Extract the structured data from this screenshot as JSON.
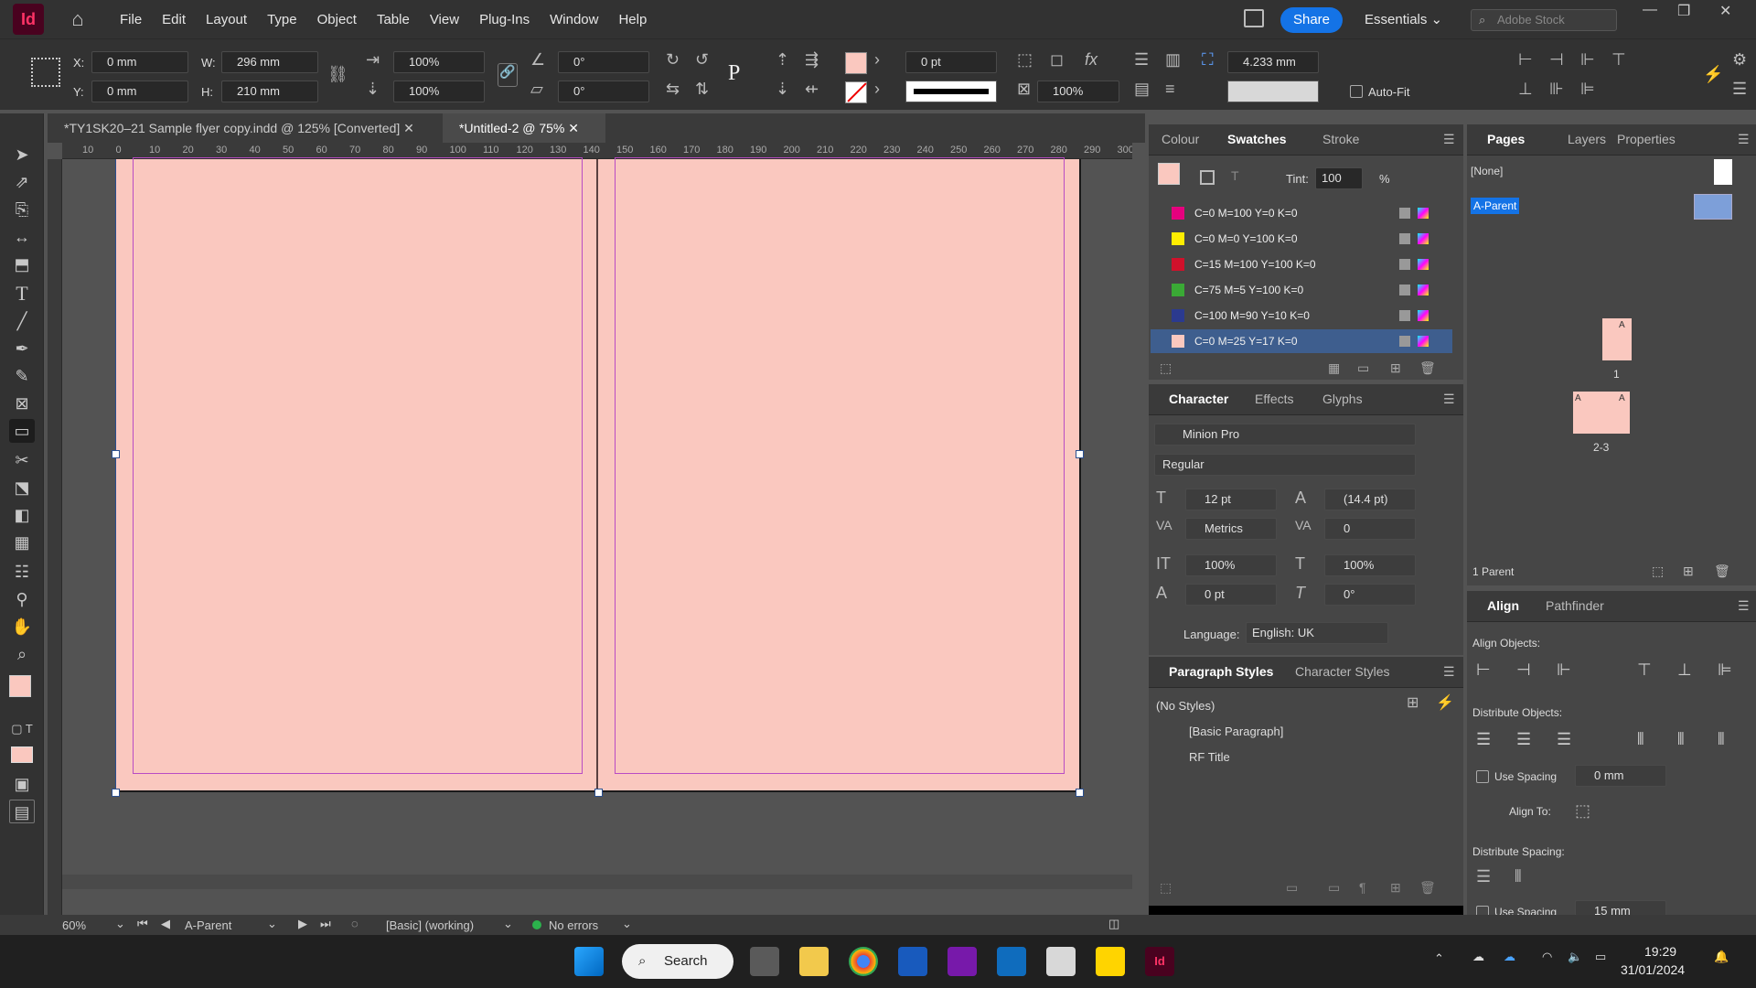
{
  "app": {
    "logo": "Id"
  },
  "menu": [
    "File",
    "Edit",
    "Layout",
    "Type",
    "Object",
    "Table",
    "View",
    "Plug-Ins",
    "Window",
    "Help"
  ],
  "share_label": "Share",
  "workspace": "Essentials",
  "stock_placeholder": "Adobe Stock",
  "control": {
    "x_label": "X:",
    "x": "0 mm",
    "y_label": "Y:",
    "y": "0 mm",
    "w_label": "W:",
    "w": "296 mm",
    "h_label": "H:",
    "h": "210 mm",
    "scale_x": "100%",
    "scale_y": "100%",
    "rotate": "0°",
    "shear": "0°",
    "stroke_weight": "0 pt",
    "opacity": "100%",
    "gutter": "4.233 mm",
    "autofit": "Auto-Fit"
  },
  "tabs": [
    {
      "label": "*TY1SK20–21 Sample flyer copy.indd @ 125% [Converted]"
    },
    {
      "label": "*Untitled-2 @ 75%"
    }
  ],
  "ruler_marks": [
    "10",
    "0",
    "10",
    "20",
    "30",
    "40",
    "50",
    "60",
    "70",
    "80",
    "90",
    "100",
    "110",
    "120",
    "130",
    "140",
    "150",
    "160",
    "170",
    "180",
    "190",
    "200",
    "210",
    "220",
    "230",
    "240",
    "250",
    "260",
    "270",
    "280",
    "290",
    "300"
  ],
  "swatches_panel": {
    "tabs": [
      "Colour",
      "Swatches",
      "Stroke"
    ],
    "tint_label": "Tint:",
    "tint": "100",
    "tint_unit": "%",
    "items": [
      {
        "name": "C=0 M=100 Y=0 K=0",
        "color": "#e6007e"
      },
      {
        "name": "C=0 M=0 Y=100 K=0",
        "color": "#ffed00"
      },
      {
        "name": "C=15 M=100 Y=100 K=0",
        "color": "#d0112b"
      },
      {
        "name": "C=75 M=5 Y=100 K=0",
        "color": "#3aa935"
      },
      {
        "name": "C=100 M=90 Y=10 K=0",
        "color": "#2b3a8f"
      },
      {
        "name": "C=0 M=25 Y=17 K=0",
        "color": "#fac8bf"
      }
    ]
  },
  "character_panel": {
    "tabs": [
      "Character",
      "Effects",
      "Glyphs"
    ],
    "font": "Minion Pro",
    "style": "Regular",
    "size": "12 pt",
    "leading": "(14.4 pt)",
    "kerning": "Metrics",
    "tracking": "0",
    "vscale": "100%",
    "hscale": "100%",
    "baseline": "0 pt",
    "skew": "0°",
    "language_label": "Language:",
    "language": "English: UK"
  },
  "paragraph_panel": {
    "tabs": [
      "Paragraph Styles",
      "Character Styles"
    ],
    "current": "(No Styles)",
    "items": [
      "[Basic Paragraph]",
      "RF Title"
    ]
  },
  "pages_panel": {
    "tabs": [
      "Pages",
      "Layers",
      "Properties"
    ],
    "none": "[None]",
    "parent": "A-Parent",
    "page1": "1",
    "spread": "2-3",
    "badge": "A",
    "footer": "1 Parent"
  },
  "align_panel": {
    "tabs": [
      "Align",
      "Pathfinder"
    ],
    "align_objects": "Align Objects:",
    "distribute_objects": "Distribute Objects:",
    "use_spacing": "Use Spacing",
    "spacing1": "0 mm",
    "align_to": "Align To:",
    "distribute_spacing": "Distribute Spacing:",
    "spacing2": "15 mm"
  },
  "status": {
    "zoom": "60%",
    "page": "A-Parent",
    "profile": "[Basic] (working)",
    "errors": "No errors"
  },
  "taskbar": {
    "search": "Search",
    "time": "19:29",
    "date": "31/01/2024"
  },
  "colors": {
    "page_fill": "#fac8bf",
    "margin": "#b94cc4",
    "accent": "#1473e6"
  }
}
